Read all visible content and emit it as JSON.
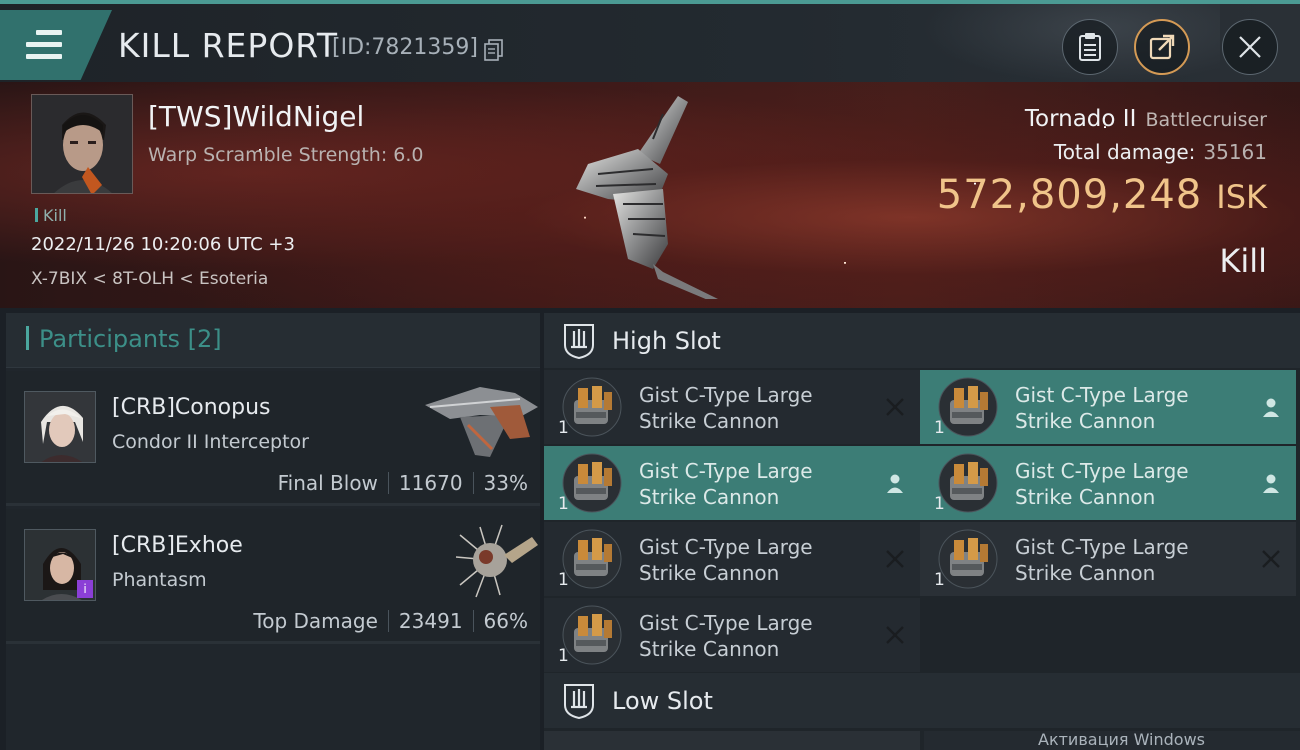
{
  "header": {
    "title": "KILL REPORT",
    "report_id": "[ID:7821359]"
  },
  "victim": {
    "name": "[TWS]WildNigel",
    "warp_scramble": "Warp Scramble Strength: 6.0",
    "kill_tag": "Kill",
    "datetime": "2022/11/26 10:20:06 UTC +3",
    "location": "X-7BIX < 8T-OLH < Esoteria",
    "ship_name": "Tornado II",
    "ship_class": "Battlecruiser",
    "total_damage_label": "Total damage:",
    "total_damage": "35161",
    "isk_value": "572,809,248",
    "isk_unit": "ISK",
    "result": "Kill"
  },
  "participants": {
    "label": "Participants [2]",
    "items": [
      {
        "name": "[CRB]Conopus",
        "ship": "Condor II Interceptor",
        "role": "Final Blow",
        "damage": "11670",
        "percent": "33%"
      },
      {
        "name": "[CRB]Exhoe",
        "ship": "Phantasm",
        "role": "Top Damage",
        "damage": "23491",
        "percent": "66%"
      }
    ]
  },
  "fitting": {
    "high_slot_label": "High Slot",
    "low_slot_label": "Low Slot",
    "modules": [
      {
        "line1": "Gist C-Type Large",
        "line2": "Strike Cannon",
        "qty": "1",
        "state": "destroyed"
      },
      {
        "line1": "Gist C-Type Large",
        "line2": "Strike Cannon",
        "qty": "1",
        "state": "dropped"
      },
      {
        "line1": "Gist C-Type Large",
        "line2": "Strike Cannon",
        "qty": "1",
        "state": "dropped"
      },
      {
        "line1": "Gist C-Type Large",
        "line2": "Strike Cannon",
        "qty": "1",
        "state": "dropped"
      },
      {
        "line1": "Gist C-Type Large",
        "line2": "Strike Cannon",
        "qty": "1",
        "state": "destroyed"
      },
      {
        "line1": "Gist C-Type Large",
        "line2": "Strike Cannon",
        "qty": "1",
        "state": "destroyed"
      },
      {
        "line1": "Gist C-Type Large",
        "line2": "Strike Cannon",
        "qty": "1",
        "state": "destroyed"
      }
    ]
  },
  "os_watermark": "Активация Windows",
  "colors": {
    "accent": "#3c7d76",
    "isk": "#f0c48a",
    "share": "#d49a55"
  }
}
